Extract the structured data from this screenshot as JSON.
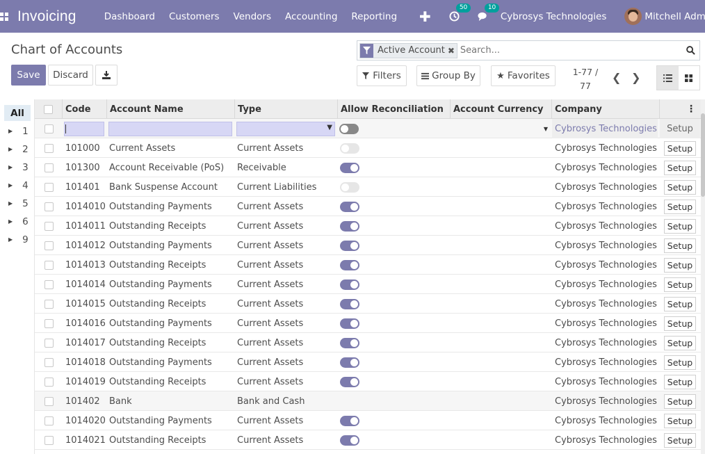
{
  "navbar": {
    "brand": "Invoicing",
    "menu": [
      "Dashboard",
      "Customers",
      "Vendors",
      "Accounting",
      "Reporting"
    ],
    "activity_count": "50",
    "messages_count": "10",
    "company": "Cybrosys Technologies",
    "user": "Mitchell Admin"
  },
  "control": {
    "breadcrumb": "Chart of Accounts",
    "save_label": "Save",
    "discard_label": "Discard",
    "facet_label": "Active Account",
    "search_placeholder": "Search...",
    "filters_label": "Filters",
    "groupby_label": "Group By",
    "favorites_label": "Favorites",
    "pager_value": "1-77 /",
    "pager_total": "77"
  },
  "side": {
    "items": [
      "All",
      "1",
      "2",
      "3",
      "4",
      "5",
      "6",
      "9"
    ]
  },
  "table": {
    "headers": [
      "Code",
      "Account Name",
      "Type",
      "Allow Reconciliation",
      "Account Currency",
      "Company"
    ],
    "edit_row": {
      "company": "Cybrosys Technologies",
      "setup": "Setup"
    },
    "rows": [
      {
        "code": "101000",
        "name": "Current Assets",
        "type": "Current Assets",
        "reconcile": "off",
        "company": "Cybrosys Technologies",
        "setup": "Setup"
      },
      {
        "code": "101300",
        "name": "Account Receivable (PoS)",
        "type": "Receivable",
        "reconcile": "on",
        "company": "Cybrosys Technologies",
        "setup": "Setup"
      },
      {
        "code": "101401",
        "name": "Bank Suspense Account",
        "type": "Current Liabilities",
        "reconcile": "off",
        "company": "Cybrosys Technologies",
        "setup": "Setup"
      },
      {
        "code": "1014010",
        "name": "Outstanding Payments",
        "type": "Current Assets",
        "reconcile": "on",
        "company": "Cybrosys Technologies",
        "setup": "Setup"
      },
      {
        "code": "1014011",
        "name": "Outstanding Receipts",
        "type": "Current Assets",
        "reconcile": "on",
        "company": "Cybrosys Technologies",
        "setup": "Setup"
      },
      {
        "code": "1014012",
        "name": "Outstanding Payments",
        "type": "Current Assets",
        "reconcile": "on",
        "company": "Cybrosys Technologies",
        "setup": "Setup"
      },
      {
        "code": "1014013",
        "name": "Outstanding Receipts",
        "type": "Current Assets",
        "reconcile": "on",
        "company": "Cybrosys Technologies",
        "setup": "Setup"
      },
      {
        "code": "1014014",
        "name": "Outstanding Payments",
        "type": "Current Assets",
        "reconcile": "on",
        "company": "Cybrosys Technologies",
        "setup": "Setup"
      },
      {
        "code": "1014015",
        "name": "Outstanding Receipts",
        "type": "Current Assets",
        "reconcile": "on",
        "company": "Cybrosys Technologies",
        "setup": "Setup"
      },
      {
        "code": "1014016",
        "name": "Outstanding Payments",
        "type": "Current Assets",
        "reconcile": "on",
        "company": "Cybrosys Technologies",
        "setup": "Setup"
      },
      {
        "code": "1014017",
        "name": "Outstanding Receipts",
        "type": "Current Assets",
        "reconcile": "on",
        "company": "Cybrosys Technologies",
        "setup": "Setup"
      },
      {
        "code": "1014018",
        "name": "Outstanding Payments",
        "type": "Current Assets",
        "reconcile": "on",
        "company": "Cybrosys Technologies",
        "setup": "Setup"
      },
      {
        "code": "1014019",
        "name": "Outstanding Receipts",
        "type": "Current Assets",
        "reconcile": "on",
        "company": "Cybrosys Technologies",
        "setup": "Setup"
      },
      {
        "code": "101402",
        "name": "Bank",
        "type": "Bank and Cash",
        "reconcile": "none",
        "company": "Cybrosys Technologies",
        "setup": "Setup"
      },
      {
        "code": "1014020",
        "name": "Outstanding Payments",
        "type": "Current Assets",
        "reconcile": "on",
        "company": "Cybrosys Technologies",
        "setup": "Setup"
      },
      {
        "code": "1014021",
        "name": "Outstanding Receipts",
        "type": "Current Assets",
        "reconcile": "on",
        "company": "Cybrosys Technologies",
        "setup": "Setup"
      }
    ]
  },
  "colors": {
    "primary": "#7c7bad",
    "badge": "#00a09d"
  }
}
